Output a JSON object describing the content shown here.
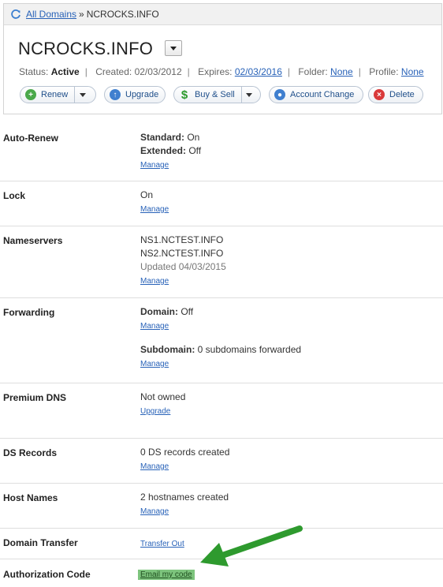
{
  "breadcrumb": {
    "all_domains": "All Domains",
    "separator": "»",
    "current": "NCROCKS.INFO"
  },
  "header": {
    "domain": "NCROCKS.INFO",
    "status_label": "Status:",
    "status_value": "Active",
    "created_label": "Created:",
    "created_value": "02/03/2012",
    "expires_label": "Expires:",
    "expires_value": "02/03/2016",
    "folder_label": "Folder:",
    "folder_value": "None",
    "profile_label": "Profile:",
    "profile_value": "None"
  },
  "actions": {
    "renew": "Renew",
    "upgrade": "Upgrade",
    "buy_sell": "Buy & Sell",
    "account_change": "Account Change",
    "delete": "Delete"
  },
  "rows": {
    "auto_renew": {
      "label": "Auto-Renew",
      "standard_label": "Standard:",
      "standard_value": " On",
      "extended_label": "Extended:",
      "extended_value": " Off",
      "link": "Manage"
    },
    "lock": {
      "label": "Lock",
      "value": "On",
      "link": "Manage"
    },
    "nameservers": {
      "label": "Nameservers",
      "ns1": "NS1.NCTEST.INFO",
      "ns2": "NS2.NCTEST.INFO",
      "updated": "Updated 04/03/2015",
      "link": "Manage"
    },
    "forwarding": {
      "label": "Forwarding",
      "domain_label": "Domain:",
      "domain_value": " Off",
      "link1": "Manage",
      "subdomain_label": "Subdomain:",
      "subdomain_value": " 0 subdomains forwarded",
      "link2": "Manage"
    },
    "premium_dns": {
      "label": "Premium DNS",
      "value": "Not owned",
      "link": "Upgrade"
    },
    "ds_records": {
      "label": "DS Records",
      "value": "0 DS records created",
      "link": "Manage"
    },
    "host_names": {
      "label": "Host Names",
      "value": "2 hostnames created",
      "link": "Manage"
    },
    "domain_transfer": {
      "label": "Domain Transfer",
      "link": "Transfer Out"
    },
    "auth_code": {
      "label": "Authorization Code",
      "link": "Email my code"
    }
  },
  "colors": {
    "link": "#2862b8",
    "highlight": "#7dc47d",
    "arrow": "#2e9a2e"
  }
}
